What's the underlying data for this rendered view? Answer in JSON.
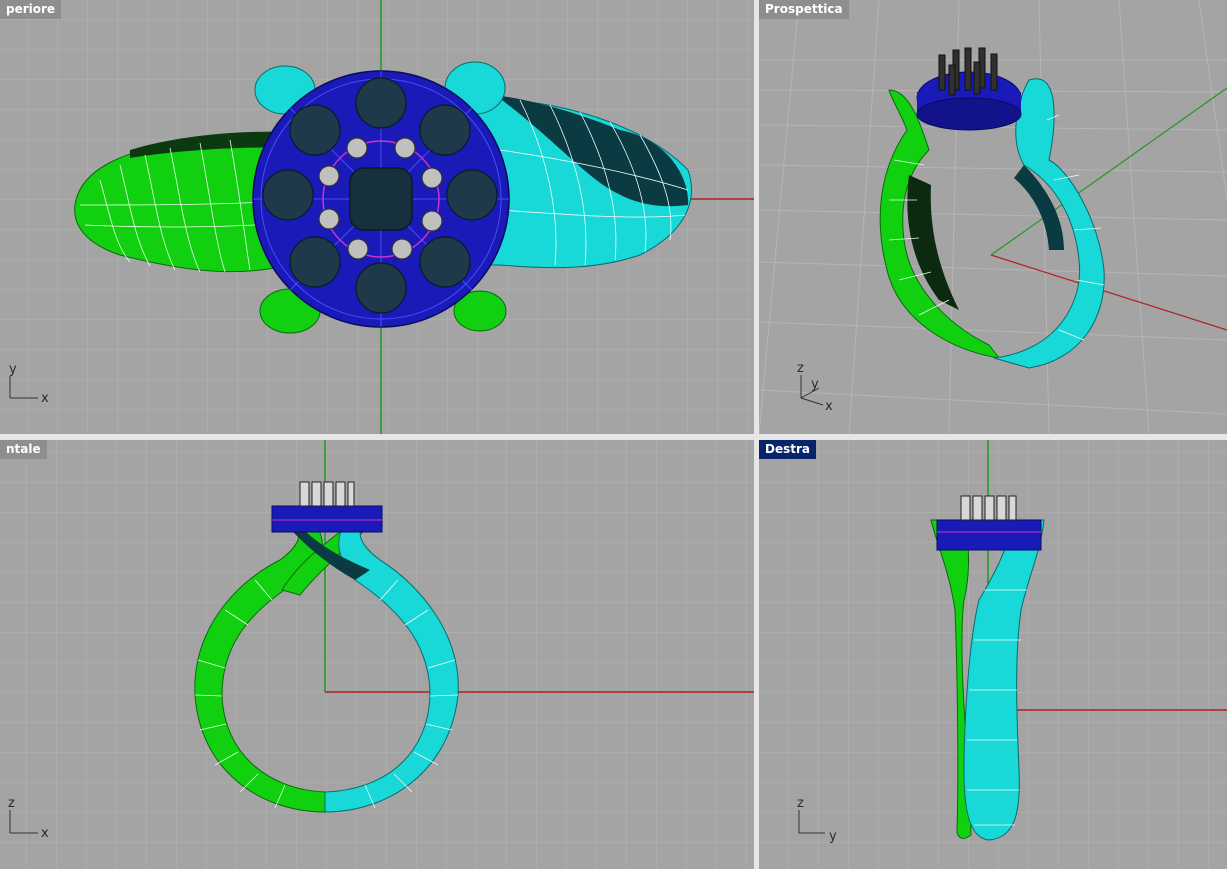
{
  "viewports": {
    "top": {
      "title": "periore",
      "axis_v": "y",
      "axis_h": "x",
      "active": false
    },
    "perspective": {
      "title": "Prospettica",
      "axis_z": "z",
      "axis_v": "y",
      "axis_h": "x",
      "active": false
    },
    "front": {
      "title": "ntale",
      "axis_v": "z",
      "axis_h": "x",
      "active": false
    },
    "right": {
      "title": "Destra",
      "axis_v": "z",
      "axis_h": "y",
      "active": true
    }
  },
  "colors": {
    "background": "#a4a4a4",
    "grid_minor": "#b3b3b3",
    "grid_major": "#8c8c8c",
    "x_axis": "#b02020",
    "y_axis": "#1f9a1f",
    "shank_left": "#10d010",
    "shank_right": "#19d8d8",
    "bezel": "#1a1ab8",
    "stones": "#1e3a4a",
    "prongs": "#c0c0c0",
    "title_active": "#0a246a",
    "title_inactive": "#8e8e8e"
  },
  "icons": [
    "axis-gizmo-icon"
  ]
}
